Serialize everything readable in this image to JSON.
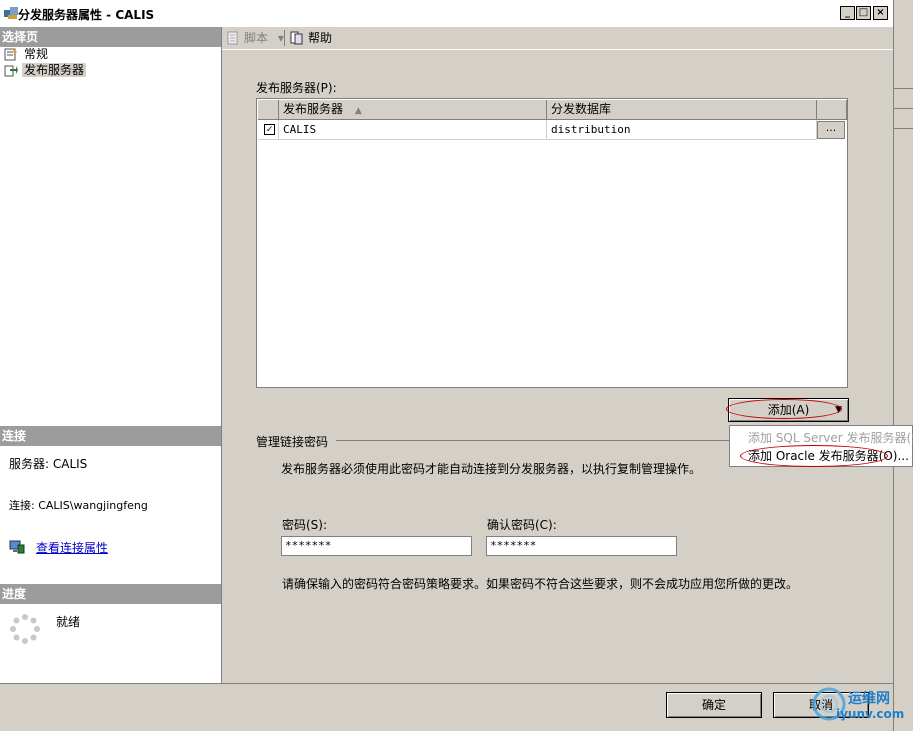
{
  "window": {
    "title": "分发服务器属性 - CALIS",
    "min_glyph": "_",
    "max_glyph": "□",
    "close_glyph": "×"
  },
  "left_pane": {
    "select_page_header": "选择页",
    "pages": [
      {
        "label": "常规",
        "icon": "properties-icon"
      },
      {
        "label": "发布服务器",
        "icon": "page-arrow-icon",
        "selected": true
      }
    ],
    "connection_header": "连接",
    "server_label": "服务器: CALIS",
    "connection_label": "连接: CALIS\\wangjingfeng",
    "view_connection_link": "查看连接属性",
    "progress_header": "进度",
    "progress_status": "就绪"
  },
  "toolbar": {
    "script_label": "脚本",
    "script_dropdown_glyph": "▾",
    "help_label": "帮助"
  },
  "publishers": {
    "section_label": "发布服务器(P):",
    "columns": [
      {
        "label": "发布服务器",
        "sort_glyph": "▲"
      },
      {
        "label": "分发数据库"
      }
    ],
    "rows": [
      {
        "checked": true,
        "check_glyph": "✓",
        "publisher": "CALIS",
        "database": "distribution",
        "ellipsis": "..."
      }
    ]
  },
  "add_button": {
    "label": "添加(A)",
    "dropdown_glyph": "▼"
  },
  "add_menu": {
    "items": [
      {
        "label": "添加 SQL Server 发布服务器(S",
        "enabled": false
      },
      {
        "label": "添加 Oracle 发布服务器(O)...",
        "enabled": true
      }
    ]
  },
  "admin_link_password": {
    "group_label": "管理链接密码",
    "description": "发布服务器必须使用此密码才能自动连接到分发服务器，以执行复制管理操作。",
    "password_label": "密码(S):",
    "password_value": "*******",
    "confirm_label": "确认密码(C):",
    "confirm_value": "*******",
    "policy_note": "请确保输入的密码符合密码策略要求。如果密码不符合这些要求，则不会成功应用您所做的更改。"
  },
  "footer": {
    "ok_label": "确定",
    "cancel_label": "取消"
  },
  "watermark": {
    "text": "运维网",
    "url_text": "iyunv.com"
  },
  "colors": {
    "dialog_bg": "#d4d0c8",
    "section_header": "#9c9c9c",
    "link": "#0000cc",
    "highlight_ellipse": "#c00000"
  }
}
